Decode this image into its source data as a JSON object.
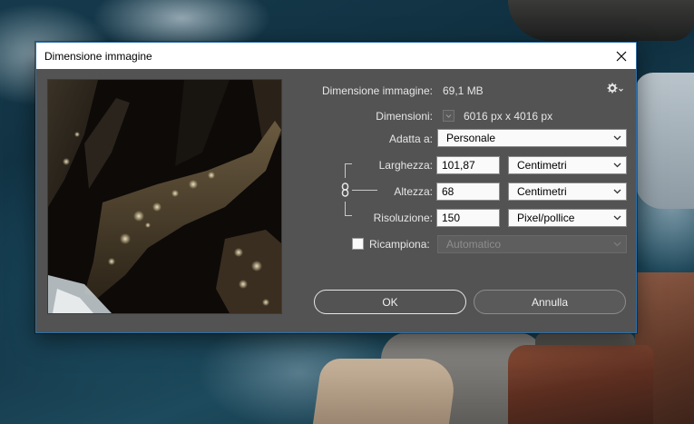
{
  "window": {
    "title": "Dimensione immagine",
    "close_glyph": "✕"
  },
  "info": {
    "size_label": "Dimensione immagine:",
    "size_value": "69,1 MB",
    "dimensions_label": "Dimensioni:",
    "dimensions_value": "6016 px x 4016 px"
  },
  "fit": {
    "label": "Adatta a:",
    "value": "Personale"
  },
  "width": {
    "label": "Larghezza:",
    "value": "101,87",
    "unit": "Centimetri"
  },
  "height": {
    "label": "Altezza:",
    "value": "68",
    "unit": "Centimetri"
  },
  "resolution": {
    "label": "Risoluzione:",
    "value": "150",
    "unit": "Pixel/pollice"
  },
  "resample": {
    "label": "Ricampiona:",
    "checked": false,
    "value": "Automatico"
  },
  "buttons": {
    "ok": "OK",
    "cancel": "Annulla"
  },
  "icons": {
    "settings": "gear-icon",
    "link": "chain-link-icon",
    "close": "close-icon",
    "dropdown": "chevron-down-icon"
  }
}
